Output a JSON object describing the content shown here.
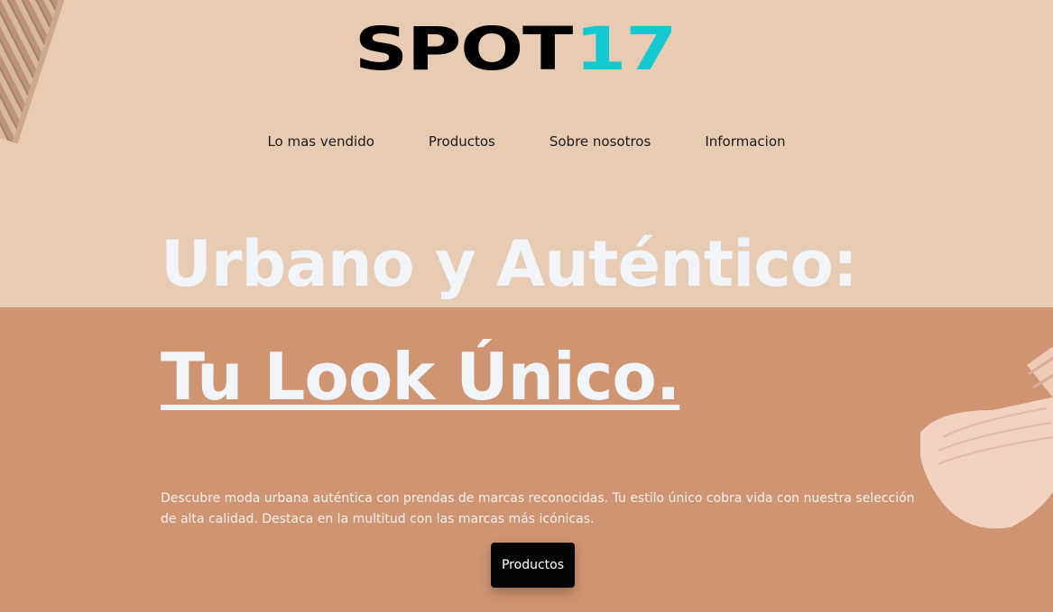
{
  "brand": {
    "logo_part1": "SPOT",
    "logo_part2": "17",
    "logo_color_dark": "#000000",
    "logo_color_accent": "#14c8cf"
  },
  "nav": {
    "items": [
      {
        "label": "Lo mas vendido"
      },
      {
        "label": "Productos"
      },
      {
        "label": "Sobre nosotros"
      },
      {
        "label": "Informacion"
      }
    ]
  },
  "hero": {
    "headline_line1": "Urbano y Auténtico:",
    "headline_line2": "Tu Look Único.",
    "description": "Descubre moda urbana auténtica con prendas de marcas reconocidas. Tu estilo único cobra vida con nuestra selección de alta calidad. Destaca en la multitud con las marcas más icónicas.",
    "cta_label": "Productos"
  },
  "colors": {
    "top_background": "#e8cbb3",
    "bottom_background": "#cf9572",
    "headline": "#f1f4f9",
    "button": "#050505"
  },
  "icons": {
    "left_decoration": "patterned-fabric-image",
    "right_decoration": "bucket-hat-image"
  }
}
